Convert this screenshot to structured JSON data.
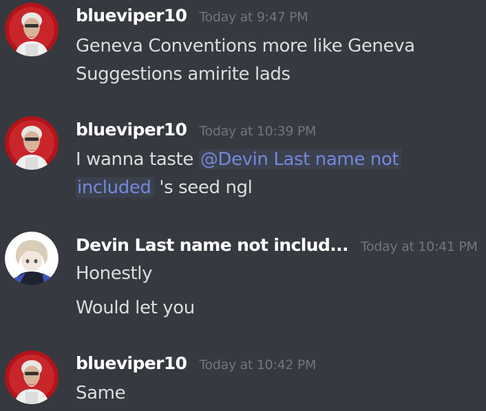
{
  "messages": [
    {
      "author": "blueviper10",
      "timestamp": "Today at 9:47 PM",
      "lines": [
        "Geneva Conventions more like Geneva",
        "Suggestions amirite lads"
      ]
    },
    {
      "author": "blueviper10",
      "timestamp": "Today at 10:39 PM",
      "line1_prefix": "I wanna taste ",
      "mention_part1": "@Devin Last name not",
      "mention_part2": "included",
      "line2_suffix": " 's seed ngl"
    },
    {
      "author": "Devin Last name not includ...",
      "timestamp": "Today at 10:41 PM",
      "lines": [
        "Honestly",
        "Would let you"
      ]
    },
    {
      "author": "blueviper10",
      "timestamp": "Today at 10:42 PM",
      "lines": [
        "Same"
      ]
    }
  ],
  "colors": {
    "background": "#36393f",
    "username": "#ffffff",
    "timestamp": "#72767d",
    "text": "#dcddde",
    "mention": "#7289da"
  },
  "icons": {
    "blueviper10_avatar": "colonel-sanders-avatar-icon",
    "devin_avatar": "anime-character-avatar-icon"
  }
}
